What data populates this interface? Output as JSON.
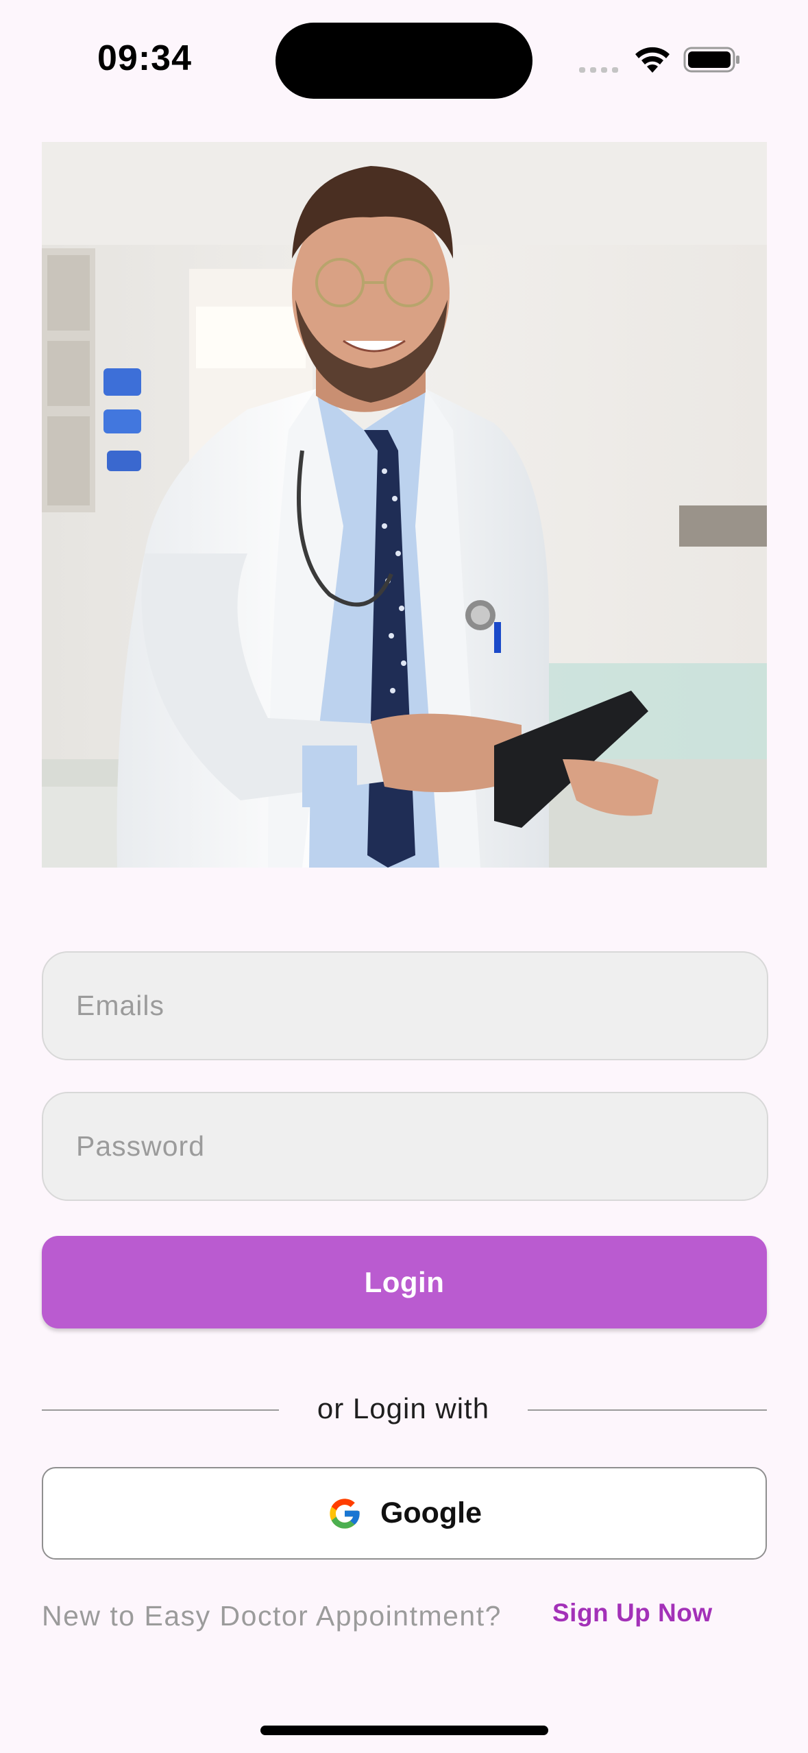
{
  "status_bar": {
    "time": "09:34"
  },
  "hero": {
    "image_icon": "doctor-photo"
  },
  "form": {
    "email_placeholder": "Emails",
    "email_value": "",
    "password_placeholder": "Password",
    "password_value": "",
    "login_label": "Login"
  },
  "divider": {
    "text": "or Login with"
  },
  "social": {
    "google_label": "Google",
    "google_icon": "google-g-icon"
  },
  "signup": {
    "prompt": "New to Easy Doctor Appointment?",
    "link_label": "Sign Up Now"
  },
  "colors": {
    "background": "#fdf6fc",
    "accent": "#ba5bd0",
    "link": "#a331b8",
    "field_bg": "#efefef"
  }
}
